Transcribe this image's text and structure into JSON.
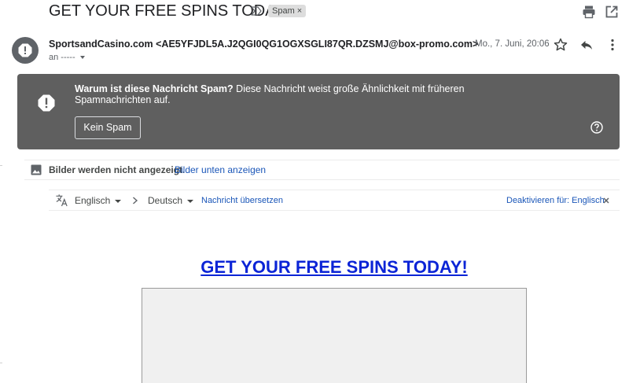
{
  "email": {
    "subject": "GET YOUR FREE SPINS TODAY!",
    "label": "Spam",
    "label_close": "×",
    "sender": "SportsandCasino.com <AE5YFJDL5A.J2QGI0QG1OGXSGLI87QR.DZSMJ@box-promo.com>",
    "recipient": "an -----",
    "date": "Mo., 7. Juni, 20:06"
  },
  "spam_warning": {
    "heading": "Warum ist diese Nachricht Spam?",
    "text": "Diese Nachricht weist große Ähnlichkeit mit früheren Spamnachrichten auf.",
    "button": "Kein Spam"
  },
  "images_notice": {
    "text": "Bilder werden nicht angezeigt.",
    "link": "Bilder unten anzeigen"
  },
  "translate": {
    "source": "Englisch",
    "target": "Deutsch",
    "action": "Nachricht übersetzen",
    "disable": "Deaktivieren für: Englisch"
  },
  "body": {
    "headline": "GET YOUR FREE SPINS TODAY!"
  },
  "icons": {
    "importance": "importance-marker-icon",
    "print": "print-icon",
    "open_new_window": "open-in-new-window-icon",
    "avatar": "exclamation-icon",
    "star": "star-icon",
    "reply": "reply-icon",
    "more": "more-vertical-icon",
    "spam_warning": "warning-octagon-icon",
    "help": "help-icon",
    "image": "image-icon",
    "translate": "translate-icon",
    "close": "close-icon"
  },
  "colors": {
    "spam_banner": "#5f5f5f",
    "link": "#1a56b8",
    "headline_link": "#0b24d6"
  }
}
